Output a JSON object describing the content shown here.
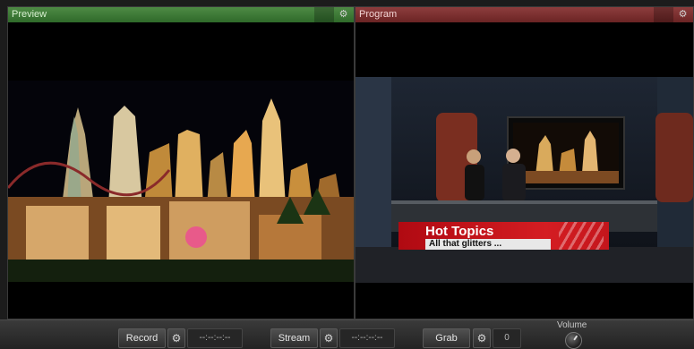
{
  "preview": {
    "title": "Preview",
    "settings_icon": "gear-icon"
  },
  "program": {
    "title": "Program",
    "settings_icon": "gear-icon",
    "lower_third": {
      "title": "Hot Topics",
      "subtitle": "All that glitters ..."
    }
  },
  "controls": {
    "record": {
      "label": "Record",
      "timecode": "--:--:--:--"
    },
    "stream": {
      "label": "Stream",
      "timecode": "--:--:--:--"
    },
    "grab": {
      "label": "Grab",
      "count": "0"
    },
    "volume": {
      "label": "Volume"
    }
  },
  "colors": {
    "preview_header": "#3f7a38",
    "program_header": "#7c2f2f",
    "lower_third_red": "#c8161d"
  }
}
